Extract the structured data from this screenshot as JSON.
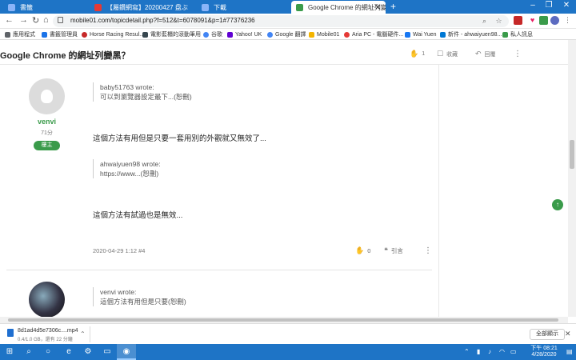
{
  "browser": {
    "tabs": [
      {
        "label": "書籤",
        "color": "#1a73e8",
        "active": false
      },
      {
        "label": "【屬鑽網寫】20200427 盘ぶ",
        "color": "#e53935",
        "active": false
      },
      {
        "label": "下載",
        "color": "#1a73e8",
        "active": false
      },
      {
        "label": "Google Chrome 的網址列變黑？",
        "color": "#3a9b4a",
        "active": true
      }
    ],
    "new_tab": "+",
    "window_controls": [
      "–",
      "❐",
      "✕"
    ],
    "url": "mobile01.com/topicdetail.php?f=512&t=6078091&p=1#77376236",
    "bookmarks": [
      {
        "label": "應用程式",
        "color": "#5f6368"
      },
      {
        "label": "書籤管理員",
        "color": "#1a73e8"
      },
      {
        "label": "Horse Racing Resul...",
        "color": "#c62828"
      },
      {
        "label": "電影藍櫃的滾動筆用",
        "color": "#37474f"
      },
      {
        "label": "谷歌",
        "color": "#4285f4"
      },
      {
        "label": "Yahoo! UK",
        "color": "#6001d2"
      },
      {
        "label": "Google 翻譯",
        "color": "#4285f4"
      },
      {
        "label": "Mobile01",
        "color": "#f4b400"
      },
      {
        "label": "Aria PC - 電腦硬件...",
        "color": "#e53935"
      },
      {
        "label": "Wai Yuen",
        "color": "#1877f2"
      },
      {
        "label": "新件 - ahwaiyuen98...",
        "color": "#0078d4"
      },
      {
        "label": "私人訊息",
        "color": "#3a9b4a"
      }
    ]
  },
  "page": {
    "title": "Google Chrome 的網址列變黑？",
    "actions": {
      "like_count": "1",
      "save": "收藏",
      "reply": "回覆"
    }
  },
  "post1": {
    "username": "venvi",
    "score": "71分",
    "badge": "樓主",
    "quote1_author": "baby51763 wrote:",
    "quote1_text": "可以到瀏覽器設定最下...(恕刪)",
    "body1": "這個方法有用但是只要一套用別的外觀就又無效了...",
    "quote2_author": "ahwaiyuen98 wrote:",
    "quote2_text": "https://www...(恕刪)",
    "body2": "這個方法有試過也是無效...",
    "timestamp": "2020-04-29 1:12 #4",
    "likes": "0",
    "quote_label": "引言"
  },
  "post2": {
    "quote_author": "venvi wrote:",
    "quote_text": "這個方法有用但是只要(恕刪)"
  },
  "downloads": {
    "filename": "8d1ad4d5e7306c....mp4",
    "status": "0.4/1.0 GB，還有 22 分鐘",
    "show_all": "全部顯示"
  },
  "taskbar": {
    "time": "下午 08:21",
    "date": "4/28/2020"
  }
}
